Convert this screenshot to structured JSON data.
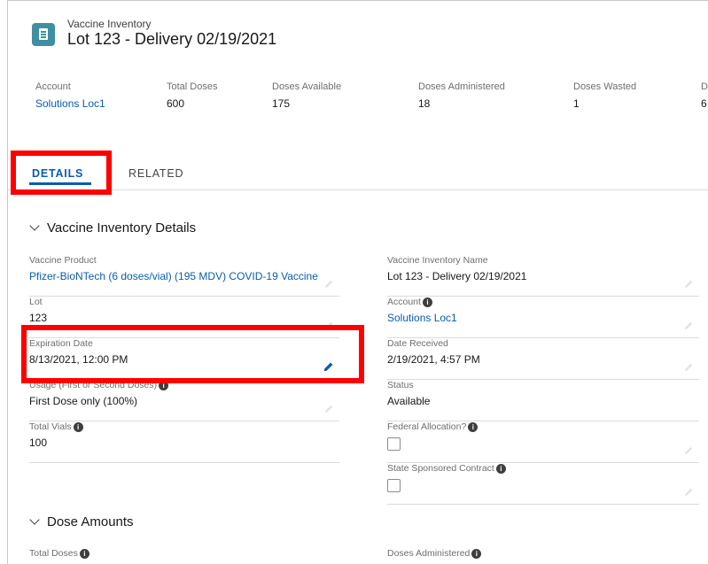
{
  "header": {
    "object_type": "Vaccine Inventory",
    "title": "Lot 123 - Delivery 02/19/2021",
    "icon": "vaccine-inventory-icon"
  },
  "highlights": [
    {
      "label": "Account",
      "value": "Solutions Loc1",
      "is_link": true
    },
    {
      "label": "Total Doses",
      "value": "600"
    },
    {
      "label": "Doses Available",
      "value": "175"
    },
    {
      "label": "Doses Administered",
      "value": "18"
    },
    {
      "label": "Doses Wasted",
      "value": "1"
    },
    {
      "label": "D",
      "value": "6"
    }
  ],
  "tabs": [
    {
      "label": "DETAILS",
      "active": true
    },
    {
      "label": "RELATED",
      "active": false
    }
  ],
  "sections": {
    "details_title": "Vaccine Inventory Details",
    "dose_amounts_title": "Dose Amounts"
  },
  "fields": {
    "vaccine_product": {
      "label": "Vaccine Product",
      "value": "Pfizer-BioNTech (6 doses/vial) (195 MDV) COVID-19 Vaccine"
    },
    "inventory_name": {
      "label": "Vaccine Inventory Name",
      "value": "Lot 123 - Delivery 02/19/2021"
    },
    "lot": {
      "label": "Lot",
      "value": "123"
    },
    "account": {
      "label": "Account",
      "value": "Solutions Loc1"
    },
    "expiration_date": {
      "label": "Expiration Date",
      "value": "8/13/2021, 12:00 PM"
    },
    "date_received": {
      "label": "Date Received",
      "value": "2/19/2021, 4:57 PM"
    },
    "usage": {
      "label": "Usage (First or Second Doses)",
      "value": "First Dose only (100%)"
    },
    "status": {
      "label": "Status",
      "value": "Available"
    },
    "total_vials": {
      "label": "Total Vials",
      "value": "100"
    },
    "federal_allocation": {
      "label": "Federal Allocation?",
      "checked": false
    },
    "state_sponsored": {
      "label": "State Sponsored Contract",
      "checked": false
    },
    "total_doses": {
      "label": "Total Doses"
    },
    "doses_administered": {
      "label": "Doses Administered"
    }
  },
  "info_glyph": "i",
  "colors": {
    "link": "#0b5cab",
    "highlight_box": "#ff0000",
    "icon_bg": "#3f8ea1"
  }
}
